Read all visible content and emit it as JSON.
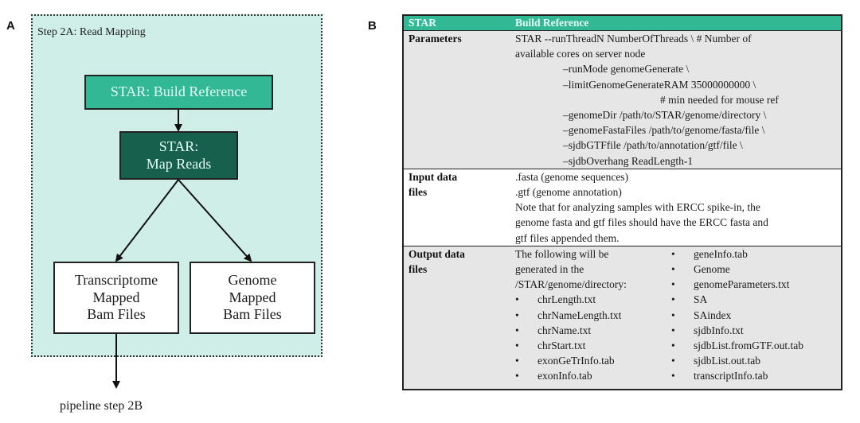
{
  "panel_a": {
    "letter": "A",
    "stage_title": "Step 2A: Read Mapping",
    "nodes": {
      "build_reference": "STAR: Build Reference",
      "map_reads": [
        "STAR:",
        "Map Reads"
      ],
      "transcriptome_bam": [
        "Transcriptome",
        "Mapped",
        "Bam Files"
      ],
      "genome_bam": [
        "Genome",
        "Mapped",
        "Bam Files"
      ]
    },
    "next_step": "pipeline step 2B",
    "colors": {
      "stage_bg": "#cfeee7",
      "build_reference_fill": "#32b894",
      "map_reads_fill": "#17604e"
    }
  },
  "panel_b": {
    "letter": "B",
    "header": {
      "col1": "STAR",
      "col2": "Build Reference"
    },
    "parameters": {
      "label": "Parameters",
      "lines": [
        "STAR --runThreadN NumberOfThreads \\ # Number of",
        "available cores on server node",
        "–runMode genomeGenerate \\",
        "–limitGenomeGenerateRAM 35000000000 \\",
        "# min needed for mouse ref",
        "–genomeDir /path/to/STAR/genome/directory \\",
        "–genomeFastaFiles /path/to/genome/fasta/file \\",
        "–sjdbGTFfile /path/to/annotation/gtf/file \\",
        "–sjdbOverhang ReadLength-1"
      ]
    },
    "input": {
      "label": [
        "Input data",
        "files"
      ],
      "lines": [
        ".fasta (genome sequences)",
        ".gtf (genome annotation)",
        "Note that for analyzing samples with ERCC spike-in, the",
        "genome fasta and gtf files should have the ERCC fasta and",
        "gtf files appended them."
      ]
    },
    "output": {
      "label": [
        "Output data",
        "files"
      ],
      "intro": [
        "The following will be",
        "generated in the",
        "/STAR/genome/directory:"
      ],
      "bullet": "•",
      "left_files": [
        "chrLength.txt",
        "chrNameLength.txt",
        "chrName.txt",
        "chrStart.txt",
        "exonGeTrInfo.tab",
        "exonInfo.tab"
      ],
      "right_files": [
        "geneInfo.tab",
        "Genome",
        "genomeParameters.txt",
        "SA",
        "SAindex",
        "sjdbInfo.txt",
        "sjdbList.fromGTF.out.tab",
        "sjdbList.out.tab",
        "transcriptInfo.tab"
      ]
    },
    "colors": {
      "header_fill": "#32b894",
      "row_gray": "#e6e6e6"
    }
  }
}
